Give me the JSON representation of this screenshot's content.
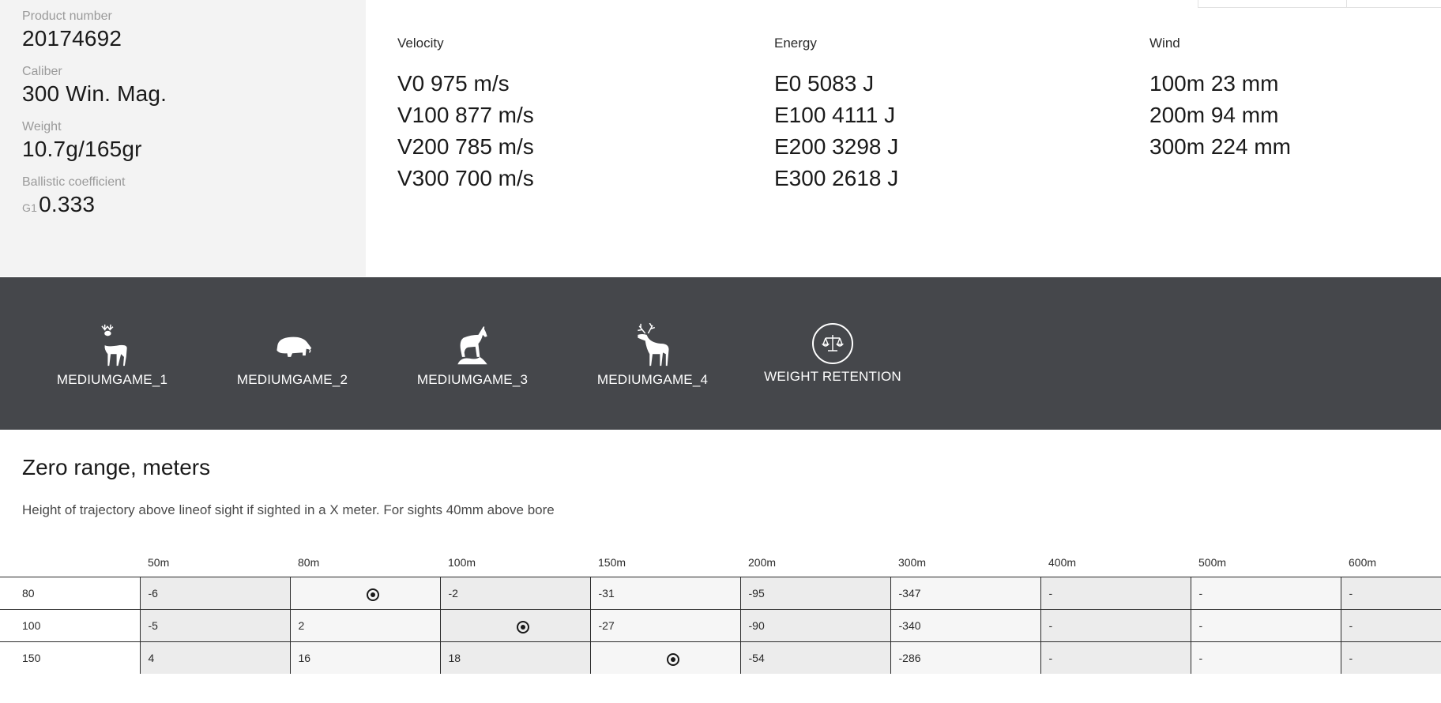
{
  "specs": {
    "product_number_label": "Product number",
    "product_number": "20174692",
    "caliber_label": "Caliber",
    "caliber": "300 Win. Mag.",
    "weight_label": "Weight",
    "weight": "10.7g/165gr",
    "bc_label": "Ballistic coefficient",
    "bc_prefix": "G1",
    "bc_value": "0.333"
  },
  "ballistics": {
    "velocity": {
      "title": "Velocity",
      "lines": [
        "V0 975 m/s",
        "V100 877 m/s",
        "V200 785 m/s",
        "V300 700 m/s"
      ]
    },
    "energy": {
      "title": "Energy",
      "lines": [
        "E0 5083 J",
        "E100 4111 J",
        "E200 3298 J",
        "E300 2618 J"
      ]
    },
    "wind": {
      "title": "Wind",
      "lines": [
        "100m 23 mm",
        "200m 94 mm",
        "300m 224 mm"
      ]
    }
  },
  "game": {
    "items": [
      {
        "label": "MEDIUMGAME_1",
        "icon": "deer-icon"
      },
      {
        "label": "MEDIUMGAME_2",
        "icon": "boar-icon"
      },
      {
        "label": "MEDIUMGAME_3",
        "icon": "chamois-icon"
      },
      {
        "label": "MEDIUMGAME_4",
        "icon": "elk-icon"
      },
      {
        "label": "WEIGHT RETENTION",
        "icon": "scale-icon"
      }
    ],
    "band_color": "#45474b"
  },
  "zero": {
    "title": "Zero range, meters",
    "subtitle": "Height of trajectory above lineof sight if sighted in a X meter. For sights 40mm above bore",
    "columns": [
      "50m",
      "80m",
      "100m",
      "150m",
      "200m",
      "300m",
      "400m",
      "500m",
      "600m"
    ],
    "rows": [
      {
        "range": "80",
        "cells": [
          "-6",
          "",
          "-2",
          "-31",
          "-95",
          "-347",
          "-",
          "-",
          "-"
        ]
      },
      {
        "range": "100",
        "cells": [
          "-5",
          "2",
          "",
          "-27",
          "-90",
          "-340",
          "-",
          "-",
          "-"
        ]
      },
      {
        "range": "150",
        "cells": [
          "4",
          "16",
          "18",
          "",
          "-54",
          "-286",
          "-",
          "-",
          "-"
        ]
      }
    ]
  }
}
